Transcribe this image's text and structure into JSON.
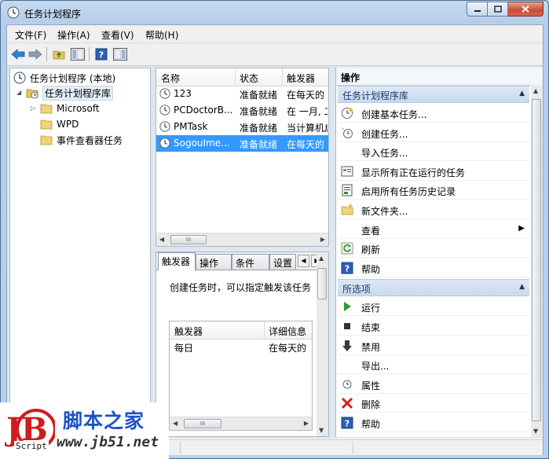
{
  "window": {
    "title": "任务计划程序"
  },
  "menu": [
    "文件(F)",
    "操作(A)",
    "查看(V)",
    "帮助(H)"
  ],
  "tree": {
    "root": "任务计划程序 (本地)",
    "library": "任务计划程序库",
    "children": [
      "Microsoft",
      "WPD",
      "事件查看器任务"
    ]
  },
  "task_list": {
    "columns": [
      "名称",
      "状态",
      "触发器"
    ],
    "rows": [
      {
        "name": "123",
        "status": "准备就绪",
        "trigger": "在每天的"
      },
      {
        "name": "PCDoctorB...",
        "status": "准备就绪",
        "trigger": "在 一月, 二"
      },
      {
        "name": "PMTask",
        "status": "准备就绪",
        "trigger": "当计算机启"
      },
      {
        "name": "SogouIme...",
        "status": "准备就绪",
        "trigger": "在每天的"
      }
    ],
    "selected_index": 3
  },
  "detail": {
    "tabs": [
      "触发器",
      "操作",
      "条件",
      "设置"
    ],
    "active_tab": 0,
    "description": "创建任务时，可以指定触发该任务",
    "table_columns": [
      "触发器",
      "详细信息"
    ],
    "table_rows": [
      {
        "trigger": "每日",
        "details": "在每天的"
      }
    ]
  },
  "actions": {
    "header": "操作",
    "sections": [
      {
        "title": "任务计划程序库",
        "items": [
          "创建基本任务...",
          "创建任务...",
          "导入任务...",
          "显示所有正在运行的任务",
          "启用所有任务历史记录",
          "新文件夹...",
          "查看",
          "刷新",
          "帮助"
        ]
      },
      {
        "title": "所选项",
        "items": [
          "运行",
          "结束",
          "禁用",
          "导出...",
          "属性",
          "删除",
          "帮助"
        ]
      }
    ]
  },
  "watermark": {
    "logo_text": "JB",
    "script": "Script",
    "site_name": "脚本之家",
    "url": "www.jb51.net"
  },
  "colors": {
    "selection": "#3399ff",
    "section_header": "#c9daee",
    "watermark_blue": "#1c53c4",
    "watermark_red": "#d01c1c"
  }
}
